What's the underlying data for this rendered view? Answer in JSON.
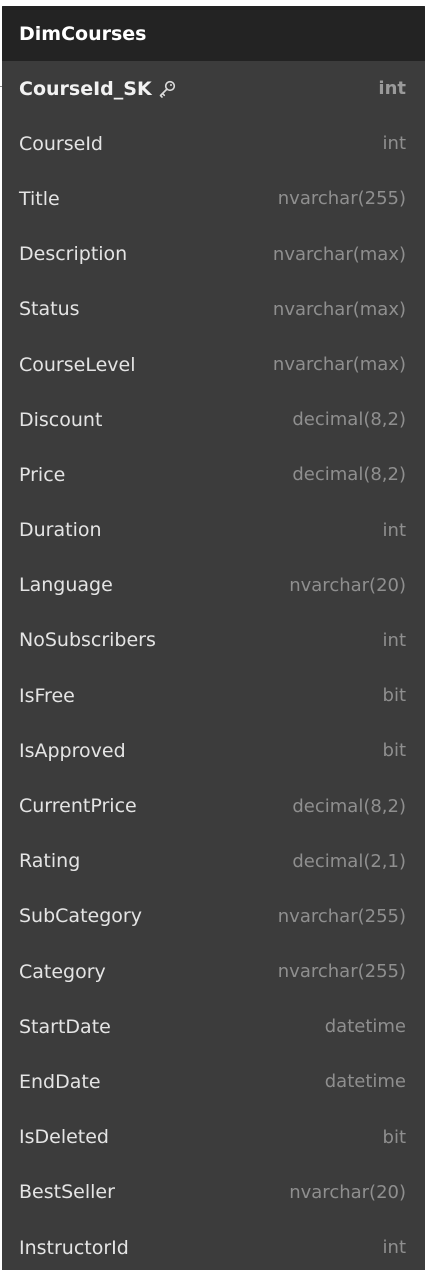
{
  "table": {
    "name": "DimCourses",
    "columns": [
      {
        "name": "CourseId_SK",
        "type": "int",
        "primary_key": true,
        "icon": "key-icon"
      },
      {
        "name": "CourseId",
        "type": "int"
      },
      {
        "name": "Title",
        "type": "nvarchar(255)"
      },
      {
        "name": "Description",
        "type": "nvarchar(max)"
      },
      {
        "name": "Status",
        "type": "nvarchar(max)"
      },
      {
        "name": "CourseLevel",
        "type": "nvarchar(max)"
      },
      {
        "name": "Discount",
        "type": "decimal(8,2)"
      },
      {
        "name": "Price",
        "type": "decimal(8,2)"
      },
      {
        "name": "Duration",
        "type": "int"
      },
      {
        "name": "Language",
        "type": "nvarchar(20)"
      },
      {
        "name": "NoSubscribers",
        "type": "int"
      },
      {
        "name": "IsFree",
        "type": "bit"
      },
      {
        "name": "IsApproved",
        "type": "bit"
      },
      {
        "name": "CurrentPrice",
        "type": "decimal(8,2)"
      },
      {
        "name": "Rating",
        "type": "decimal(2,1)"
      },
      {
        "name": "SubCategory",
        "type": "nvarchar(255)"
      },
      {
        "name": "Category",
        "type": "nvarchar(255)"
      },
      {
        "name": "StartDate",
        "type": "datetime"
      },
      {
        "name": "EndDate",
        "type": "datetime"
      },
      {
        "name": "IsDeleted",
        "type": "bit"
      },
      {
        "name": "BestSeller",
        "type": "nvarchar(20)"
      },
      {
        "name": "InstructorId",
        "type": "int"
      }
    ]
  },
  "colors": {
    "header_bg": "#232323",
    "body_bg": "#3c3c3c",
    "name_text": "#e4e4e4",
    "type_text": "#8f8f8f"
  }
}
